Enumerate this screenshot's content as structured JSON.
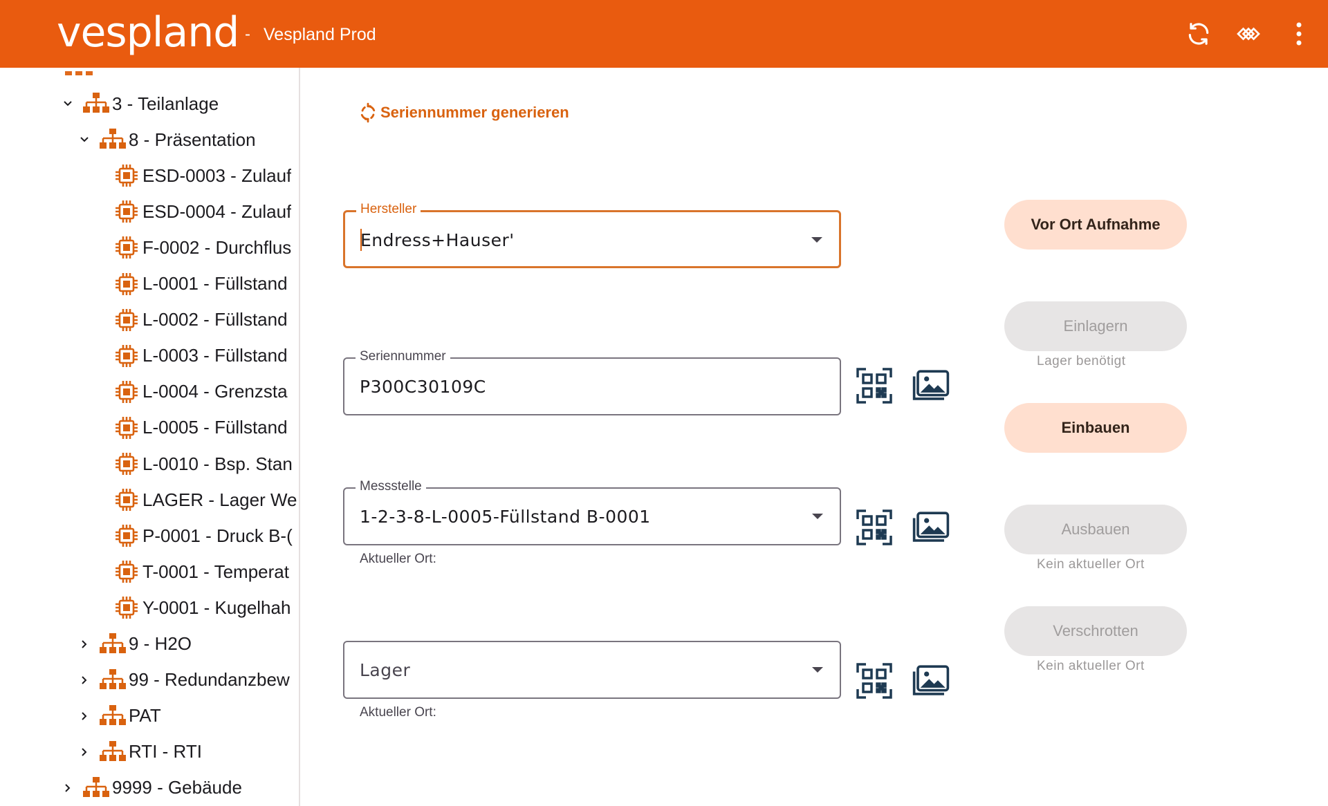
{
  "header": {
    "logo": "vespland",
    "separator": "-",
    "environment": "Vespland Prod",
    "icons": [
      "refresh-icon",
      "sync-icon",
      "more-vert-icon"
    ]
  },
  "tree": {
    "items": [
      {
        "label": "3 - Teilanlage",
        "type": "group",
        "expanded": true
      },
      {
        "label": "8 - Präsentation",
        "type": "group",
        "expanded": true
      },
      {
        "label": "ESD-0003 - Zulauf",
        "type": "device"
      },
      {
        "label": "ESD-0004 - Zulauf",
        "type": "device"
      },
      {
        "label": "F-0002 - Durchflus",
        "type": "device"
      },
      {
        "label": "L-0001 - Füllstand",
        "type": "device"
      },
      {
        "label": "L-0002 - Füllstand",
        "type": "device"
      },
      {
        "label": "L-0003 - Füllstand",
        "type": "device"
      },
      {
        "label": "L-0004 - Grenzsta",
        "type": "device"
      },
      {
        "label": "L-0005 - Füllstand",
        "type": "device"
      },
      {
        "label": "L-0010 - Bsp. Stan",
        "type": "device"
      },
      {
        "label": "LAGER - Lager We",
        "type": "device"
      },
      {
        "label": "P-0001 - Druck B-(",
        "type": "device"
      },
      {
        "label": "T-0001 - Temperat",
        "type": "device"
      },
      {
        "label": "Y-0001 - Kugelhah",
        "type": "device"
      },
      {
        "label": "9 - H2O",
        "type": "group",
        "expanded": false
      },
      {
        "label": "99 - Redundanzbew",
        "type": "group",
        "expanded": false
      },
      {
        "label": "PAT",
        "type": "group",
        "expanded": false
      },
      {
        "label": "RTI - RTI",
        "type": "group",
        "expanded": false
      },
      {
        "label": "9999 - Gebäude",
        "type": "group",
        "expanded": false
      }
    ]
  },
  "form": {
    "generate_link": "Seriennummer generieren",
    "hersteller": {
      "label": "Hersteller",
      "value": "Endress+Hauser'"
    },
    "seriennummer": {
      "label": "Seriennummer",
      "value": "P300C30109C"
    },
    "messstelle": {
      "label": "Messstelle",
      "value": "1-2-3-8-L-0005-Füllstand B-0001",
      "helper": "Aktueller Ort:"
    },
    "lager": {
      "placeholder": "Lager",
      "helper": "Aktueller Ort:"
    }
  },
  "actions": {
    "vor_ort": {
      "label": "Vor Ort Aufnahme",
      "enabled": true
    },
    "einlagern": {
      "label": "Einlagern",
      "enabled": false,
      "hint": "Lager benötigt"
    },
    "einbauen": {
      "label": "Einbauen",
      "enabled": true
    },
    "ausbauen": {
      "label": "Ausbauen",
      "enabled": false,
      "hint": "Kein aktueller Ort"
    },
    "verschrotten": {
      "label": "Verschrotten",
      "enabled": false,
      "hint": "Kein aktueller Ort"
    }
  },
  "colors": {
    "brand": "#e95b0f",
    "accent": "#d9620f",
    "button_enabled": "#ffdfcf",
    "button_disabled": "#e7e5e5",
    "icon_dark": "#1e3a52"
  }
}
